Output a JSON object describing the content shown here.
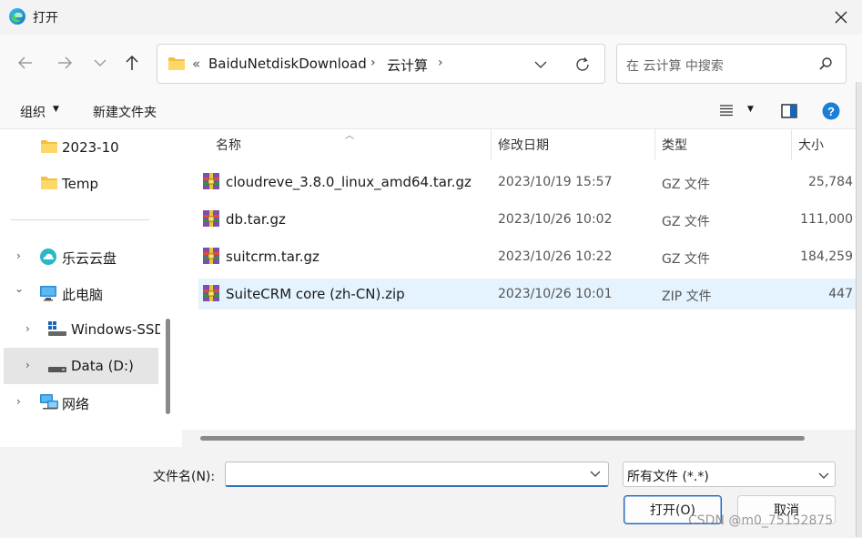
{
  "window": {
    "title": "打开",
    "close_icon": "close-icon",
    "app_icon": "edge-browser-icon"
  },
  "nav": {
    "back_icon": "arrow-left-icon",
    "forward_icon": "arrow-right-icon",
    "recent_icon": "chevron-down-icon",
    "up_icon": "arrow-up-icon",
    "address": {
      "overflow": "«",
      "crumbs": [
        "BaiduNetdiskDownload",
        "云计算"
      ],
      "separator": "›"
    },
    "search_placeholder": "在 云计算 中搜索"
  },
  "toolbar": {
    "organize": "组织",
    "new_folder": "新建文件夹"
  },
  "sidebar": {
    "items": [
      {
        "label": "2023-10",
        "icon": "folder-icon",
        "chevron": ""
      },
      {
        "label": "Temp",
        "icon": "folder-icon",
        "chevron": ""
      },
      {
        "label": "乐云云盘",
        "icon": "cloud-drive-icon",
        "chevron": "›"
      },
      {
        "label": "此电脑",
        "icon": "computer-icon",
        "chevron": "⌄"
      },
      {
        "label": "Windows-SSD",
        "icon": "windows-drive-icon",
        "chevron": "›"
      },
      {
        "label": "Data (D:)",
        "icon": "drive-icon",
        "chevron": "›"
      },
      {
        "label": "网络",
        "icon": "network-icon",
        "chevron": "›"
      }
    ]
  },
  "columns": {
    "name": "名称",
    "modified": "修改日期",
    "type": "类型",
    "size": "大小"
  },
  "files": [
    {
      "name": "cloudreve_3.8.0_linux_amd64.tar.gz",
      "modified": "2023/10/19 15:57",
      "type": "GZ 文件",
      "size": "25,784"
    },
    {
      "name": "db.tar.gz",
      "modified": "2023/10/26 10:02",
      "type": "GZ 文件",
      "size": "111,000"
    },
    {
      "name": "suitcrm.tar.gz",
      "modified": "2023/10/26 10:22",
      "type": "GZ 文件",
      "size": "184,259"
    },
    {
      "name": "SuiteCRM core (zh-CN).zip",
      "modified": "2023/10/26 10:01",
      "type": "ZIP 文件",
      "size": "447"
    }
  ],
  "footer": {
    "filename_label": "文件名(N):",
    "filename_value": "",
    "filter_value": "所有文件 (*.*)",
    "open_label": "打开(O)",
    "cancel_label": "取消",
    "watermark": "CSDN @m0_75152875"
  },
  "colors": {
    "accent": "#1a64b8",
    "selection": "#e5f3ff",
    "folder": "#f3c043"
  }
}
